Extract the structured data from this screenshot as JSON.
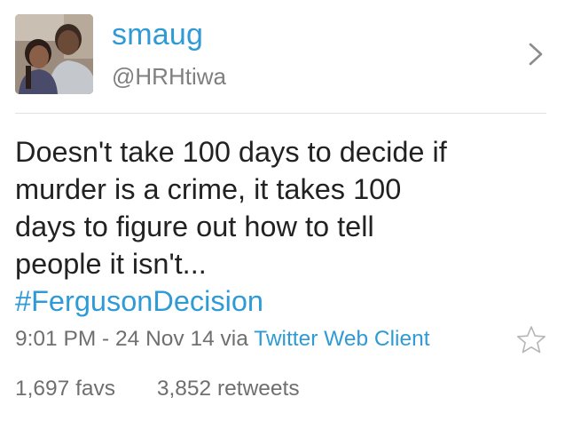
{
  "user": {
    "display_name": "smaug",
    "handle": "@HRHtiwa",
    "avatar_icon": "profile-photo"
  },
  "tweet": {
    "lines": [
      "Doesn't take 100 days to decide if",
      "murder is a crime, it takes 100",
      "days to figure out how to tell",
      "people it isn't..."
    ],
    "hashtag": "#FergusonDecision",
    "timestamp": "9:01 PM - 24 Nov 14",
    "via_label": "via",
    "client": "Twitter Web Client"
  },
  "stats": {
    "favs_count": "1,697",
    "favs_label": "favs",
    "retweets_count": "3,852",
    "retweets_label": "retweets"
  },
  "icons": {
    "chevron": "chevron-right-icon",
    "favorite": "star-outline-icon"
  },
  "colors": {
    "link_blue": "#2f9bd6",
    "text": "#222222",
    "muted": "#6f6f6f"
  }
}
